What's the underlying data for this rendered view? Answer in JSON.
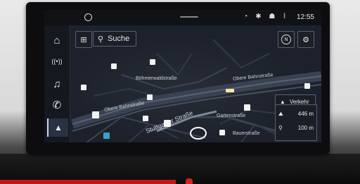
{
  "status": {
    "time": "12:55",
    "icons": "◔ ✱ ☗ ⌇"
  },
  "search": {
    "label": "Suche"
  },
  "sidebar": [
    {
      "icon": "home-icon",
      "glyph": "⌂"
    },
    {
      "icon": "radio-icon",
      "glyph": "((•))"
    },
    {
      "icon": "music-icon",
      "glyph": "♫"
    },
    {
      "icon": "phone-icon",
      "glyph": "✆"
    },
    {
      "icon": "navigation-icon",
      "glyph": "▲"
    }
  ],
  "map": {
    "streets": [
      {
        "label": "Böhmerwaldstraße"
      },
      {
        "label": "Obere Bahnstraße"
      },
      {
        "label": "Obere Bahnstraße"
      },
      {
        "label": "Stuttgarter Straße"
      },
      {
        "label": "Gartenstraße"
      },
      {
        "label": "Bauerstraße"
      }
    ]
  },
  "traffic": {
    "label": "Verkehr"
  },
  "route": {
    "distance": "446 m",
    "zoom_scale": "100 m"
  },
  "buttons": {
    "compass_label": "N"
  }
}
